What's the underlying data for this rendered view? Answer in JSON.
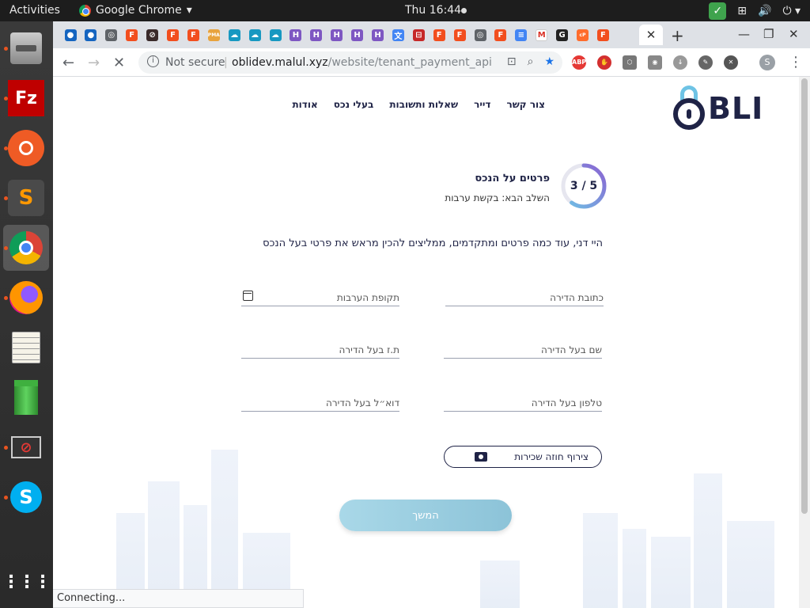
{
  "topbar": {
    "activities": "Activities",
    "app_name": "Google Chrome",
    "clock": "Thu 16:44"
  },
  "dock": {
    "items": [
      {
        "name": "files",
        "active": false
      },
      {
        "name": "filezilla",
        "label": "Fz"
      },
      {
        "name": "postman"
      },
      {
        "name": "sublime-text",
        "label": "S"
      },
      {
        "name": "chrome",
        "active": true
      },
      {
        "name": "firefox"
      },
      {
        "name": "text-editor"
      },
      {
        "name": "green-pipe"
      },
      {
        "name": "blocked-app"
      },
      {
        "name": "skype",
        "label": "S"
      },
      {
        "name": "show-apps"
      }
    ]
  },
  "tabs": {
    "favicons": [
      "●",
      "●",
      "◎",
      "F",
      "⊘",
      "F",
      "F",
      "PMA",
      "☁",
      "☁",
      "☁",
      "H",
      "H",
      "H",
      "H",
      "H",
      "文",
      "⊟",
      "F",
      "F",
      "◎",
      "F",
      "≡",
      "M",
      "G",
      "cP",
      "F"
    ],
    "new_tab": "+"
  },
  "toolbar": {
    "not_secure": "Not secure",
    "host": "oblidev.malul.xyz",
    "path": "/website/tenant_payment_api",
    "abp": "ABP"
  },
  "page": {
    "logo_text": "BLI",
    "nav": [
      "אודות",
      "בעלי נכס",
      "שאלות ותשובות",
      "דייר",
      "צור קשר"
    ],
    "progress": {
      "label": "3 / 5",
      "current": 3,
      "total": 5
    },
    "step_title": "פרטים על הנכס",
    "step_next": "השלב הבא: בקשת ערבות",
    "greeting": "היי דני, עוד כמה פרטים ומתקדמים, ממליצים להכין מראש את פרטי בעל הנכס",
    "fields": {
      "address": "כתובת הדירה",
      "period": "תקופת הערבות",
      "owner_name": "שם בעל הדירה",
      "owner_id": "ת.ז בעל הדירה",
      "owner_phone": "טלפון בעל הדירה",
      "owner_email": "דוא״ל בעל הדירה"
    },
    "attach_label": "צירוף חוזה שכירות",
    "continue_label": "המשך"
  },
  "status": "Connecting..."
}
